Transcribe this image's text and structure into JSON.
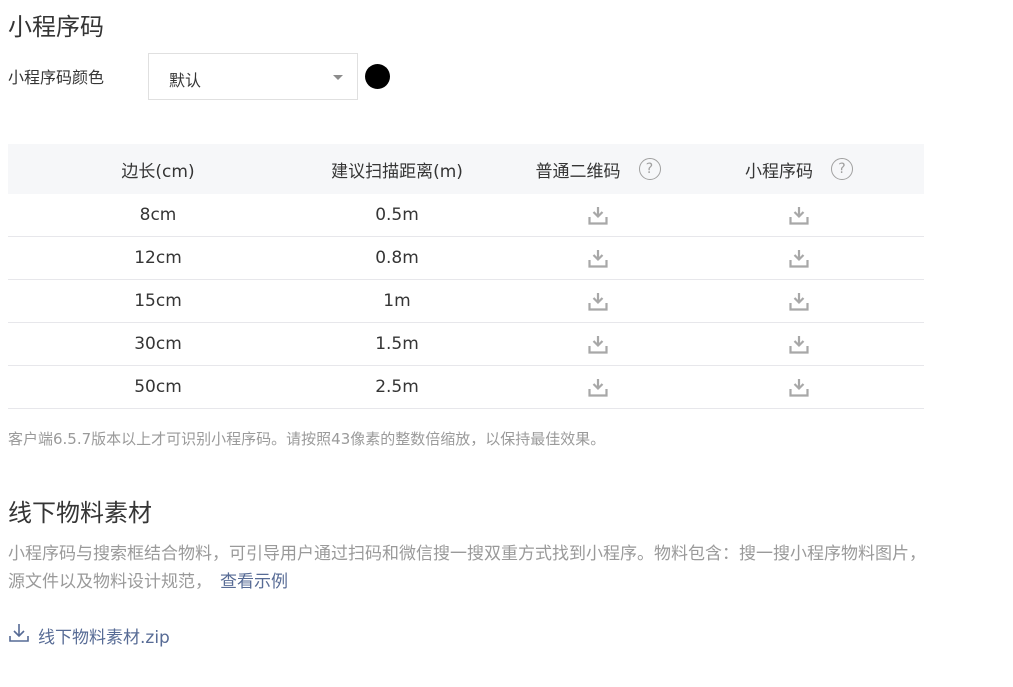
{
  "section1": {
    "title": "小程序码",
    "color_label": "小程序码颜色",
    "color_select_value": "默认",
    "swatch_color": "#000000"
  },
  "table": {
    "headers": {
      "side": "边长(cm)",
      "distance": "建议扫描距离(m)",
      "qrcode": "普通二维码",
      "miniprogram": "小程序码"
    },
    "help_glyph": "?",
    "rows": [
      {
        "side": "8cm",
        "distance": "0.5m"
      },
      {
        "side": "12cm",
        "distance": "0.8m"
      },
      {
        "side": "15cm",
        "distance": "1m"
      },
      {
        "side": "30cm",
        "distance": "1.5m"
      },
      {
        "side": "50cm",
        "distance": "2.5m"
      }
    ]
  },
  "note": "客户端6.5.7版本以上才可识别小程序码。请按照43像素的整数倍缩放，以保持最佳效果。",
  "section2": {
    "title": "线下物料素材",
    "description": "小程序码与搜索框结合物料，可引导用户通过扫码和微信搜一搜双重方式找到小程序。物料包含：搜一搜小程序物料图片，源文件以及物料设计规范，",
    "example_link": "查看示例",
    "zip_label": "线下物料素材.zip"
  },
  "colors": {
    "link": "#576b95",
    "muted_text": "#9a9a9a",
    "icon_gray": "#a8a8a8"
  }
}
